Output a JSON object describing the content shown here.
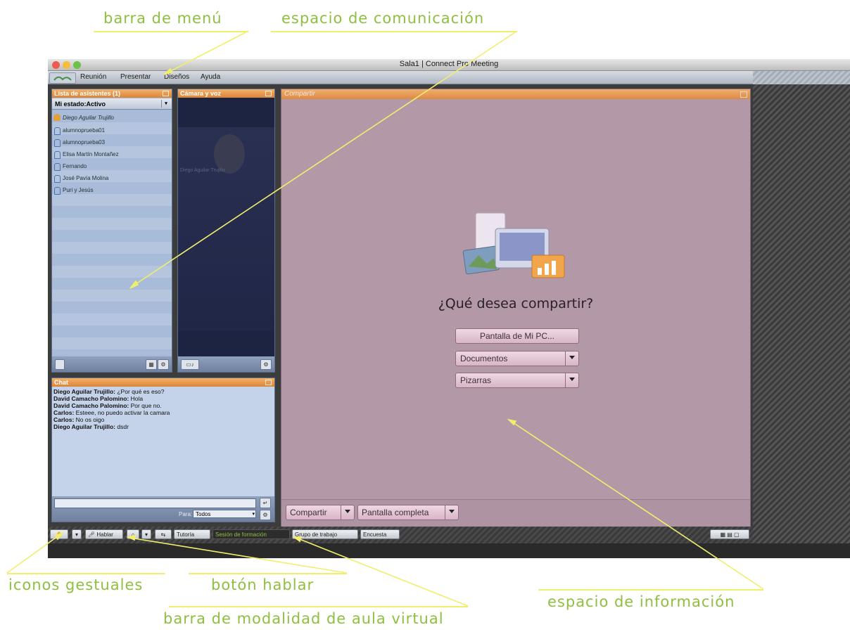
{
  "annotations": {
    "menu_bar": "barra de menú",
    "communication_space": "espacio de comunicación",
    "gesture_icons": "iconos gestuales",
    "talk_button": "botón hablar",
    "info_space": "espacio de información",
    "modality_bar": "barra de modalidad de aula virtual"
  },
  "window": {
    "title": "Sala1 | Connect Pro Meeting"
  },
  "menu": {
    "items": [
      "Reunión",
      "Presentar",
      "Diseños",
      "Ayuda"
    ]
  },
  "attendees": {
    "title": "Lista de asistentes (1)",
    "status": "Mi estado:Activo",
    "host": "Diego Aguilar Trujillo",
    "list": [
      "alumnoprueba01",
      "alumnoprueba03",
      "Elisa Martín Montañez",
      "Fernando",
      "José Pavía Molina",
      "Puri y Jesús"
    ]
  },
  "camera": {
    "title": "Cámara y voz",
    "name_overlay": "Diego Aguilar Trujillo"
  },
  "chat": {
    "title": "Chat",
    "messages": [
      {
        "author": "Diego Aguilar Trujillo:",
        "text": " ¿Por qué es eso?"
      },
      {
        "author": "David Camacho Palomino:",
        "text": " Hola"
      },
      {
        "author": "David Camacho Palomino:",
        "text": " Por que no."
      },
      {
        "author": "Carlos:",
        "text": " Esteee, no puedo activar la camara"
      },
      {
        "author": "Carlos:",
        "text": " No os oigo"
      },
      {
        "author": "Diego Aguilar Trujillo:",
        "text": " dsdr"
      }
    ],
    "to_label": "Para:",
    "to_value": "Todos"
  },
  "share": {
    "title": "Compartir",
    "question": "¿Qué desea compartir?",
    "options": [
      "Pantalla de Mi PC...",
      "Documentos",
      "Pizarras"
    ],
    "footer_share": "Compartir",
    "footer_fullscreen": "Pantalla completa"
  },
  "modebar": {
    "talk": "Hablar",
    "modes": [
      "Tutoría",
      "Sesión de formación",
      "Grupo de trabajo",
      "Encuesta"
    ]
  }
}
